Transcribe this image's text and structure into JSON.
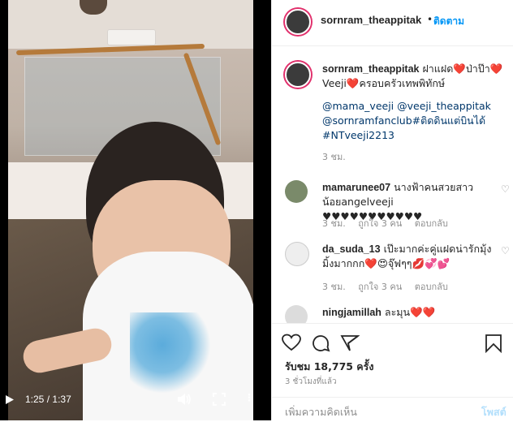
{
  "video": {
    "current_time": "1:25",
    "separator": "/",
    "duration": "1:37",
    "play_icon": "play-icon",
    "volume_icon": "volume-icon",
    "fullscreen_icon": "fullscreen-icon",
    "more_icon": "more-icon"
  },
  "header": {
    "username": "sornram_theappitak",
    "dot": "•",
    "follow_label": "ติดตาม"
  },
  "caption": {
    "username": "sornram_theappitak",
    "text_line1": "ฝาแฝด❤️ป่าป๊า❤️",
    "text_line2": "Veeji❤️ครอบครัวเทพพิทักษ์",
    "tags_line1": "@mama_veeji @veeji_theappitak",
    "tags_line2": "@sornramfanclub#ติดดินแต่บินได้",
    "tags_line3": "#NTveeji2213",
    "time": "3 ชม."
  },
  "comments": [
    {
      "username": "mamarunee07",
      "text": "นางฟ้าคนสวยสาวน้อยangelveeji ♥♥♥♥♥♥♥♥♥♥♥",
      "time": "3 ชม.",
      "likes": "ถูกใจ 3 คน",
      "reply": "ตอบกลับ"
    },
    {
      "username": "da_suda_13",
      "text": "เป๊ะมากค่ะคู่แฝดน่ารักมุ้งมิ้งมากกก❤️😍จุ๊ฟๆๆ💋💞💕",
      "time": "3 ชม.",
      "likes": "ถูกใจ 3 คน",
      "reply": "ตอบกลับ"
    },
    {
      "username": "ningjamillah",
      "text": "ละมุน❤️❤️",
      "time": "",
      "likes": "",
      "reply": ""
    }
  ],
  "actions": {
    "likes_text": "รับชม 18,775 ครั้ง",
    "ago": "3 ชั่วโมงที่แล้ว",
    "comment_placeholder": "เพิ่มความคิดเห็น",
    "post_label": "โพสต์"
  },
  "colors": {
    "accent": "#0095f6",
    "heart": "#ed4956"
  }
}
